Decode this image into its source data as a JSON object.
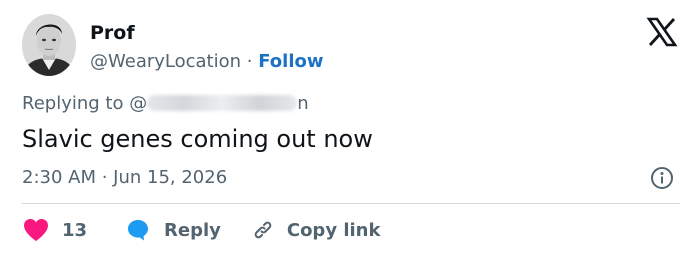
{
  "author": {
    "display_name": "Prof",
    "handle": "@WearyLocation",
    "separator": "·",
    "follow_label": "Follow"
  },
  "reply_to": {
    "prefix": "Replying to @",
    "suffix": "n"
  },
  "tweet": {
    "text": "Slavic genes coming out now",
    "timestamp": "2:30 AM · Jun 15, 2026"
  },
  "actions": {
    "like_count": "13",
    "reply_label": "Reply",
    "copy_link_label": "Copy link"
  },
  "icons": {
    "brand": "x-logo-icon",
    "info": "info-icon",
    "like": "heart-icon",
    "reply": "speech-bubble-icon",
    "copy": "link-icon"
  },
  "colors": {
    "like": "#f91880",
    "reply": "#1d9bf0",
    "follow": "#1d72c5",
    "muted": "#536471"
  }
}
